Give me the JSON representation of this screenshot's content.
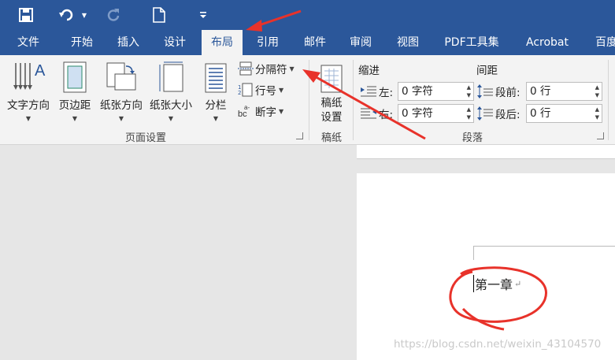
{
  "window": {
    "accent": "#2b579a",
    "quick_access": [
      "save-icon",
      "undo-icon",
      "undo-dropdown-icon",
      "redo-icon",
      "new-document-icon",
      "customize-toolbar-icon"
    ]
  },
  "ribbon_tabs": [
    "文件",
    "开始",
    "插入",
    "设计",
    "布局",
    "引用",
    "邮件",
    "审阅",
    "视图",
    "PDF工具集",
    "Acrobat",
    "百度"
  ],
  "active_tab": "布局",
  "page_setup": {
    "text_direction": "文字方向",
    "margins": "页边距",
    "orientation": "纸张方向",
    "size": "纸张大小",
    "columns": "分栏",
    "breaks": "分隔符",
    "line_numbers": "行号",
    "hyphenation": "断字",
    "group_label": "页面设置"
  },
  "manuscript": {
    "settings_line1": "稿纸",
    "settings_line2": "设置",
    "group_label": "稿纸"
  },
  "paragraph": {
    "indent_header": "缩进",
    "spacing_header": "间距",
    "left_label": "左:",
    "left_value": "0 字符",
    "right_label": "右:",
    "right_value": "0 字符",
    "before_label": "段前:",
    "before_value": "0 行",
    "after_label": "段后:",
    "after_value": "0 行",
    "group_label": "段落"
  },
  "document": {
    "body_text": "第一章",
    "paragraph_mark": "↵"
  },
  "watermark": "https://blog.csdn.net/weixin_43104570",
  "annotation_color": "#e8322a"
}
